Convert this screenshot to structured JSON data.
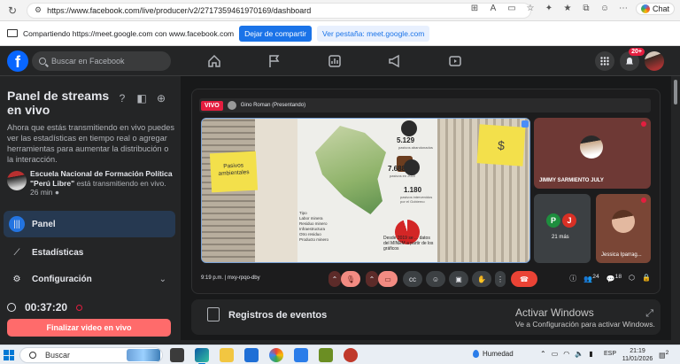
{
  "browser": {
    "url": "https://www.facebook.com/live/producer/v2/2717359461970169/dashboard",
    "chat_label": "Chat"
  },
  "share_bar": {
    "text": "Compartiendo https://meet.google.com con www.facebook.com",
    "stop_label": "Dejar de compartir",
    "view_tab_label": "Ver pestaña: meet.google.com"
  },
  "header": {
    "logo": "f",
    "search_placeholder": "Buscar en Facebook",
    "notifications_badge": "20+"
  },
  "left_panel": {
    "title": "Panel de streams en vivo",
    "description": "Ahora que estás transmitiendo en vivo puedes ver las estadísticas en tiempo real o agregar herramientas para aumentar la distribución o la interacción.",
    "streamer_name": "Escuela Nacional de Formación Política \"Perú Libre\"",
    "streamer_status": " está transmitiendo en vivo.",
    "streamer_time": "26 min",
    "menu": [
      {
        "label": "Panel"
      },
      {
        "label": "Estadísticas"
      },
      {
        "label": "Configuración"
      }
    ],
    "timer": "00:37:20",
    "end_button": "Finalizar video en vivo"
  },
  "meet": {
    "live_badge": "VIVO",
    "presenter": "Gino Roman (Presentando)",
    "slide": {
      "note_left": "Pasivos ambientales",
      "note_right": "$",
      "legend_title": "Tipo",
      "legend_items": [
        "Labor minera",
        "Residuo minero",
        "Infraestructura",
        "Otro residuo",
        "Producto minero"
      ],
      "stat1_value": "5.129",
      "stat1_sub": "pasivos abandonados",
      "stat2_value": "7.688",
      "stat2_sub": "pasivos en 2022",
      "stat3_value": "1.180",
      "stat3_sub": "pasivos intervenidos por el Gobierno",
      "caption": "Desde 2019 se ... datos del MINEM a partir de los gráficos"
    },
    "participants": [
      {
        "name": "JIMMY SARMIENTO JULY"
      },
      {
        "name": "21 más",
        "initials": [
          "P",
          "J"
        ]
      },
      {
        "name": "Jessica Iparrag..."
      }
    ],
    "meeting_time": "9:19 p.m.",
    "meeting_code": "mxy-rpqo-dby",
    "people_count": "24",
    "chat_count": "18"
  },
  "events": {
    "label": "Registros de eventos"
  },
  "watermark": {
    "line1": "Activar Windows",
    "line2": "Ve a Configuración para activar Windows."
  },
  "taskbar": {
    "search_label": "Buscar",
    "weather": "Humedad",
    "lang": "ESP",
    "time": "21:19",
    "date": "11/01/2026",
    "notif_count": "2"
  },
  "colors": {
    "fb_blue": "#0866ff",
    "active_menu": "#263951",
    "end_button": "#ff6b6b",
    "live_red": "#e41e3f"
  }
}
